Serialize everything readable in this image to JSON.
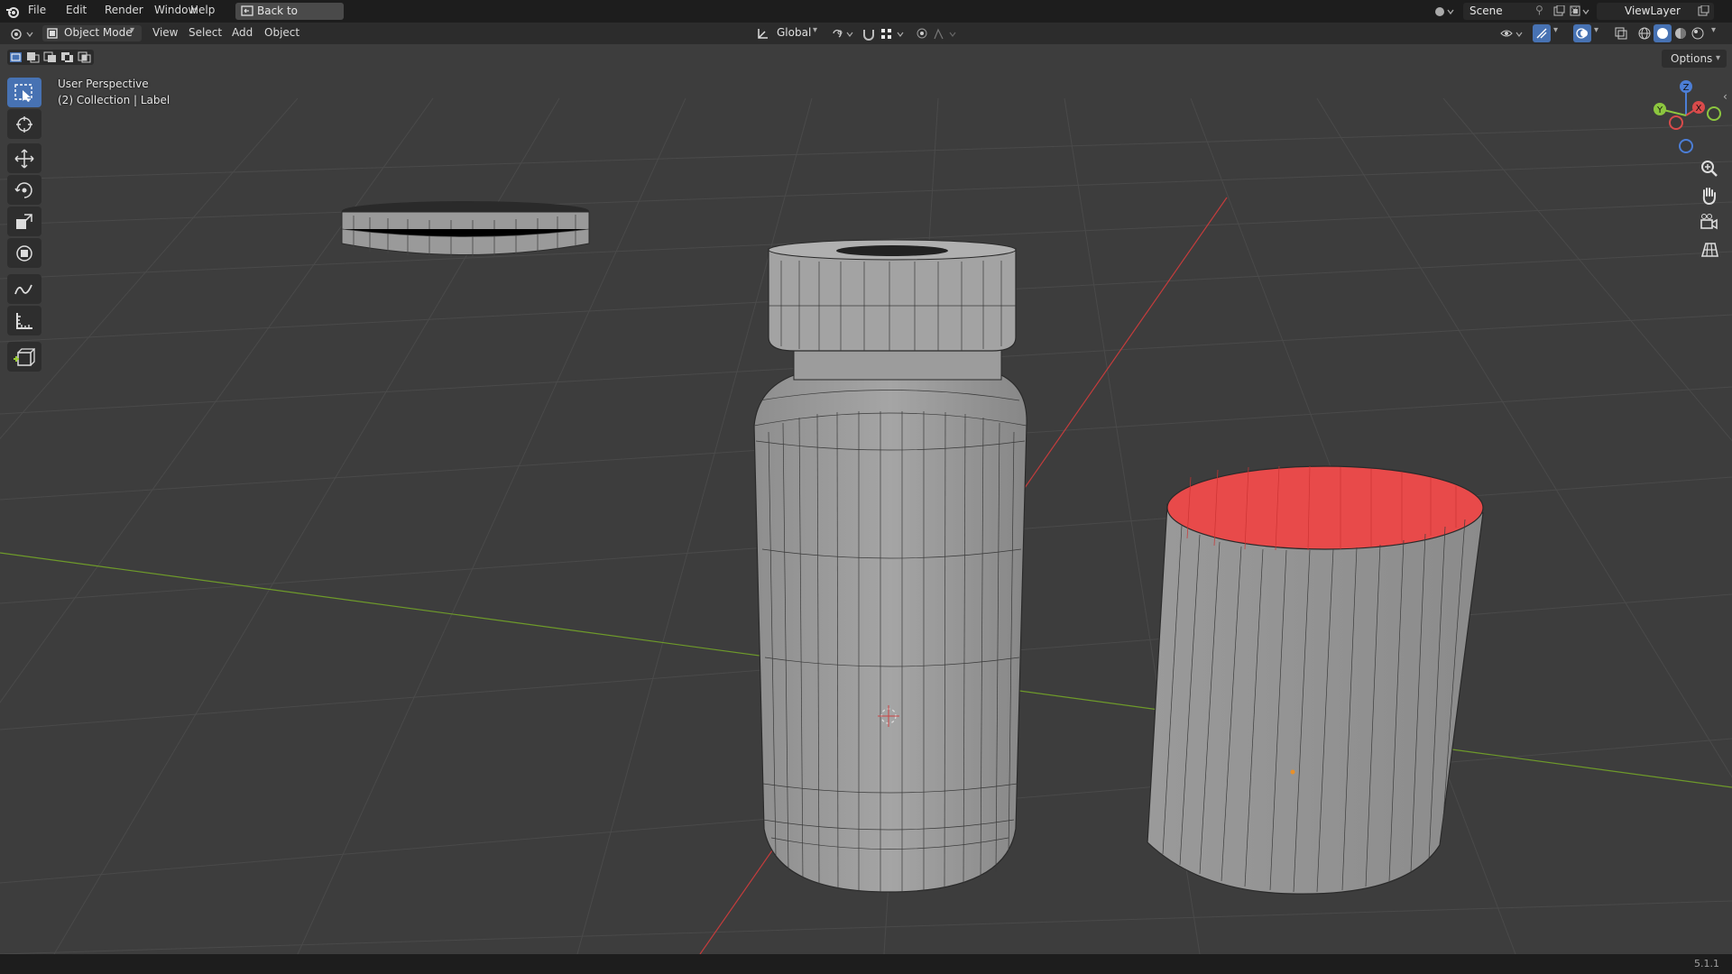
{
  "topbar": {
    "menus": [
      "File",
      "Edit",
      "Render",
      "Window",
      "Help"
    ],
    "back_label": "Back to Previous",
    "scene_label": "Scene",
    "viewlayer_label": "ViewLayer"
  },
  "header": {
    "mode_label": "Object Mode",
    "menus": [
      "View",
      "Select",
      "Add",
      "Object"
    ],
    "orientation_label": "Global",
    "options_label": "Options"
  },
  "viewport": {
    "perspective_label": "User Perspective",
    "collection_label": "(2) Collection | Label",
    "gizmo_axes": [
      "Z",
      "X",
      "Y"
    ]
  },
  "toolbar": {
    "tools": [
      "select-box-icon",
      "cursor-icon",
      "move-icon",
      "rotate-icon",
      "scale-icon",
      "transform-icon",
      "annotate-icon",
      "measure-icon",
      "add-cube-icon"
    ]
  },
  "statusbar": {
    "version": "5.1.1"
  },
  "colors": {
    "background": "#3d3d3d",
    "accent": "#4772b3",
    "x_axis": "#d94b4b",
    "y_axis": "#8cc63f",
    "label_interior": "#e84a4a"
  }
}
